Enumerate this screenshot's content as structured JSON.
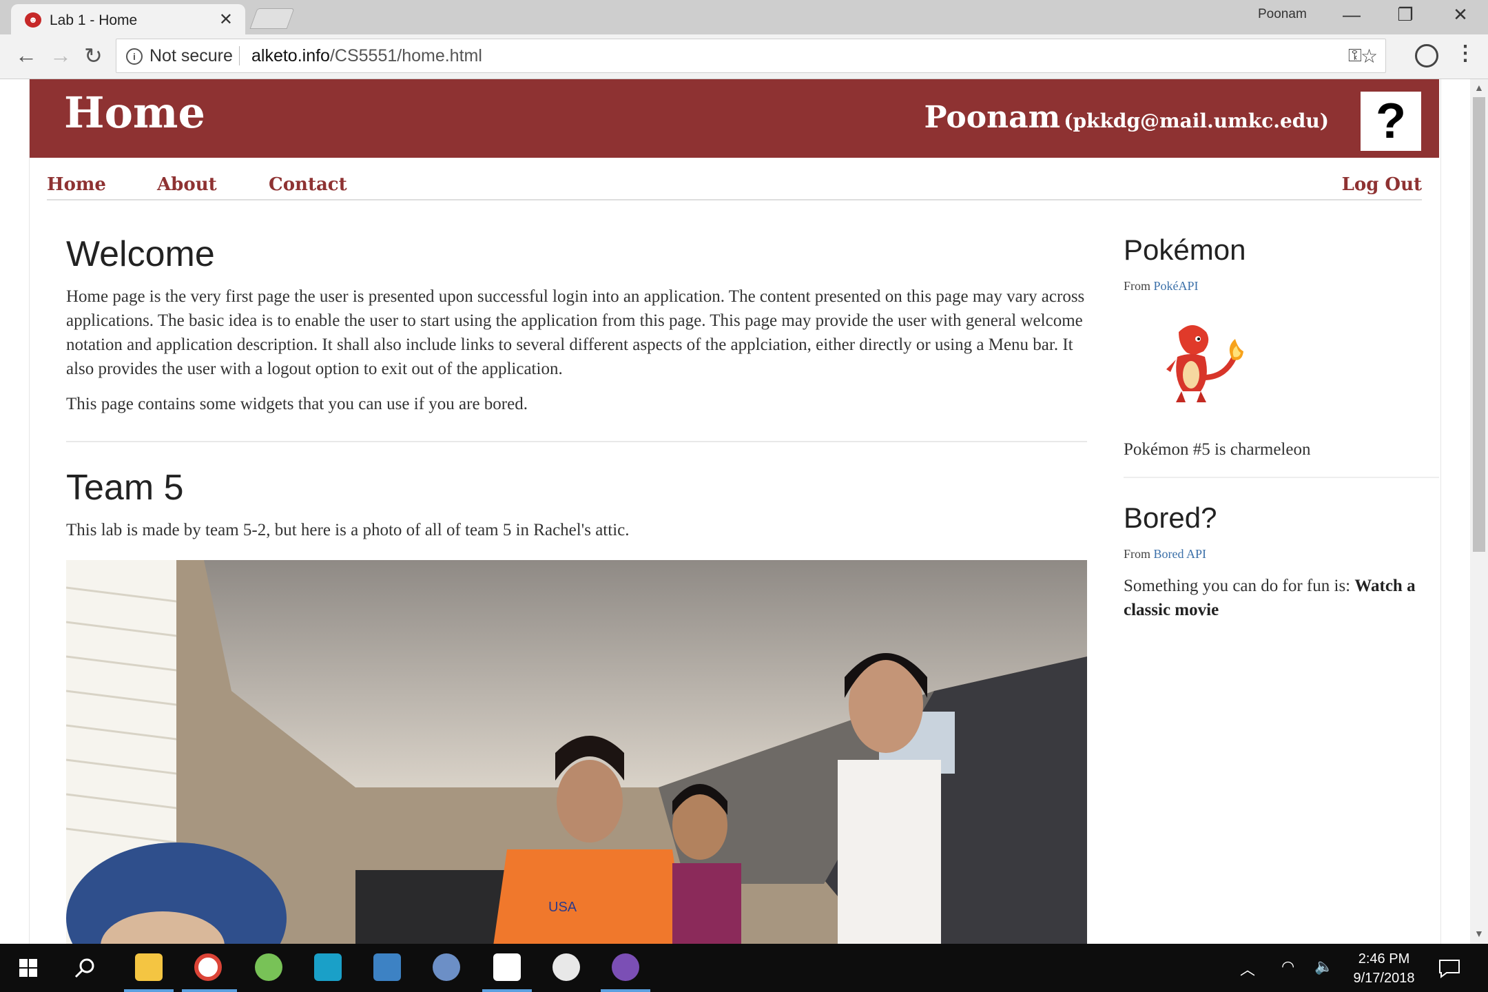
{
  "browser": {
    "tab_title": "Lab 1 - Home",
    "tab_close": "✕",
    "profile_name": "Poonam",
    "security_label": "Not secure",
    "url_host": "alketo.info",
    "url_path": "/CS5551/home.html"
  },
  "header": {
    "title": "Home",
    "user_name": "Poonam",
    "user_email": "(pkkdg@mail.umkc.edu)",
    "avatar_text": "?"
  },
  "nav": {
    "home": "Home",
    "about": "About",
    "contact": "Contact",
    "logout": "Log Out"
  },
  "main": {
    "welcome_heading": "Welcome",
    "welcome_text": "Home page is the very first page the user is presented upon successful login into an application. The content presented on this page may vary across applications. The basic idea is to enable the user to start using the application from this page. This page may provide the user with general welcome notation and application description. It shall also include links to several different aspects of the applciation, either directly or using a Menu bar. It also provides the user with a logout option to exit out of the application.",
    "widgets_text": "This page contains some widgets that you can use if you are bored.",
    "team_heading": "Team 5",
    "team_text": "This lab is made by team 5-2, but here is a photo of all of team 5 in Rachel's attic.",
    "photo_print": "USA"
  },
  "sidebar": {
    "pokemon_heading": "Pokémon",
    "pokemon_from_label": "From",
    "pokemon_from_link": "PokéAPI",
    "pokemon_text": "Pokémon #5 is charmeleon",
    "bored_heading": "Bored?",
    "bored_from_label": "From",
    "bored_from_link": "Bored API",
    "bored_prefix": "Something you can do for fun is:",
    "bored_activity": "Watch a classic movie"
  },
  "taskbar": {
    "time": "2:46 PM",
    "date": "9/17/2018"
  },
  "colors": {
    "header_bg": "#8e3232",
    "nav_link": "#8e3232",
    "link_blue": "#3a6fa8"
  }
}
